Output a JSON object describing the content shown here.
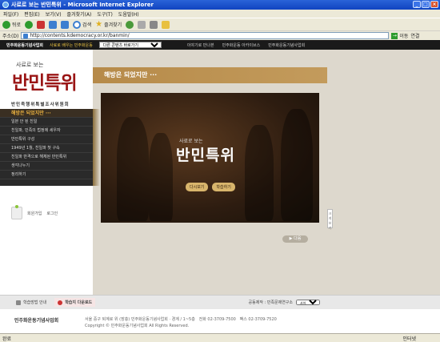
{
  "window": {
    "title": "사료로 보는 반민특위 - Microsoft Internet Explorer"
  },
  "menubar": [
    "파일(F)",
    "편집(E)",
    "보기(V)",
    "즐겨찾기(A)",
    "도구(T)",
    "도움말(H)"
  ],
  "toolbar": {
    "back": "뒤로",
    "search": "검색",
    "favorites": "즐겨찾기"
  },
  "address": {
    "label": "주소(D)",
    "url": "http://contents.kdemocracy.or.kr/banmin/",
    "go": "이동",
    "links": "연결"
  },
  "sitenav": {
    "logo": "민주화운동기념사업회",
    "promo": "사료로 배우는 민주화운동",
    "select_value": "다른 콘텐츠 바로가기",
    "links": [
      "이야기로 만나본",
      "민주화운동 아카이브스",
      "민주화운동기념사업회"
    ]
  },
  "sidebar": {
    "subtitle": "사료로 보는",
    "title": "반민특위",
    "org": "반민족행위특별조사위원회",
    "menu": [
      "해방은 되었지만 ···",
      "일본 안 된 친일",
      "친일파, 민족의 법정에 세우자",
      "반민특위 구성",
      "1949년 1월, 친일파 첫 구속",
      "친일파 반격으로 해체된 반민특위",
      "생각나누기",
      "정리하기"
    ],
    "login": {
      "join": "회원가입",
      "login": "로그인"
    }
  },
  "content": {
    "header": "해방은 되었지만 ···",
    "hero_sub": "사료로 보는",
    "hero_title": "반민특위",
    "btn_replay": "다시보기",
    "btn_study": "학습하기",
    "side_tab": "크게보기",
    "next": "다음"
  },
  "footer": {
    "guide": "학습방법 안내",
    "download": "학습지 다운로드",
    "org_label": "공동제작 : 민족문제연구소",
    "site_select": "사이트바로가기",
    "logo": "민주화운동기념사업회",
    "address": "서울 중구 퇴계로 위 (장충) 민주화운동기념사업회 · 경계 / 1~5층",
    "phone": "전화 02-3709-7500",
    "fax": "팩스 02-3709-7520",
    "copyright": "Copyright © 민주화운동기념사업회 All Rights Reserved."
  },
  "status": {
    "left": "완료",
    "zone": "인터넷"
  }
}
